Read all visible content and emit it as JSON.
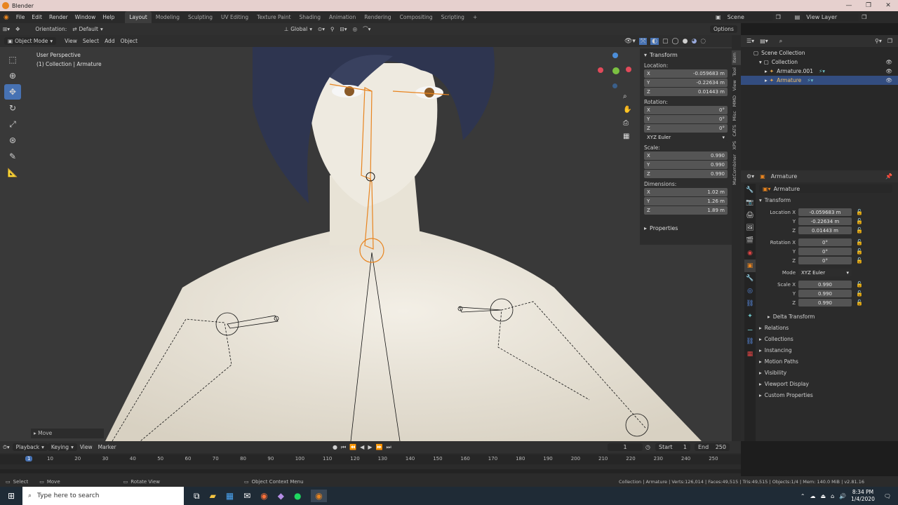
{
  "window": {
    "title": "Blender"
  },
  "menubar": {
    "menus": [
      "File",
      "Edit",
      "Render",
      "Window",
      "Help"
    ],
    "workspaces": [
      "Layout",
      "Modeling",
      "Sculpting",
      "UV Editing",
      "Texture Paint",
      "Shading",
      "Animation",
      "Rendering",
      "Compositing",
      "Scripting"
    ],
    "active_workspace": "Layout",
    "scene": "Scene",
    "view_layer": "View Layer"
  },
  "tool_header": {
    "orientation_label": "Orientation:",
    "orientation_value": "Default",
    "transform_orientation": "Global",
    "options": "Options"
  },
  "viewport_header": {
    "mode": "Object Mode",
    "menus": [
      "View",
      "Select",
      "Add",
      "Object"
    ]
  },
  "viewport": {
    "perspective": "User Perspective",
    "collection_info": "(1) Collection | Armature",
    "last_operator": "Move"
  },
  "npanel": {
    "title": "Transform",
    "location_label": "Location:",
    "location": [
      {
        "axis": "X",
        "value": "-0.059683 m"
      },
      {
        "axis": "Y",
        "value": "-0.22634 m"
      },
      {
        "axis": "Z",
        "value": "0.01443 m"
      }
    ],
    "rotation_label": "Rotation:",
    "rotation": [
      {
        "axis": "X",
        "value": "0°"
      },
      {
        "axis": "Y",
        "value": "0°"
      },
      {
        "axis": "Z",
        "value": "0°"
      }
    ],
    "rotation_mode": "XYZ Euler",
    "scale_label": "Scale:",
    "scale": [
      {
        "axis": "X",
        "value": "0.990"
      },
      {
        "axis": "Y",
        "value": "0.990"
      },
      {
        "axis": "Z",
        "value": "0.990"
      }
    ],
    "dimensions_label": "Dimensions:",
    "dimensions": [
      {
        "axis": "X",
        "value": "1.02 m"
      },
      {
        "axis": "Y",
        "value": "1.26 m"
      },
      {
        "axis": "Z",
        "value": "1.89 m"
      }
    ],
    "properties": "Properties",
    "tabs": [
      "Item",
      "Tool",
      "View",
      "MMD",
      "Misc",
      "CATS",
      "XPS",
      "MatCombiner"
    ]
  },
  "outliner": {
    "root": "Scene Collection",
    "collection": "Collection",
    "items": [
      "Armature.001",
      "Armature"
    ]
  },
  "properties": {
    "object_name": "Armature",
    "datablock": "Armature",
    "section": "Transform",
    "location_label": "Location X",
    "location": [
      "-0.059683 m",
      "-0.22634 m",
      "0.01443 m"
    ],
    "rotation_label": "Rotation X",
    "rotation": [
      "0°",
      "0°",
      "0°"
    ],
    "mode_label": "Mode",
    "mode": "XYZ Euler",
    "scale_label": "Scale X",
    "scale": [
      "0.990",
      "0.990",
      "0.990"
    ],
    "axis_y": "Y",
    "axis_z": "Z",
    "delta": "Delta Transform",
    "panels": [
      "Relations",
      "Collections",
      "Instancing",
      "Motion Paths",
      "Visibility",
      "Viewport Display",
      "Custom Properties"
    ]
  },
  "timeline": {
    "menus": [
      "Playback",
      "Keying",
      "View",
      "Marker"
    ],
    "current_frame": "1",
    "start_label": "Start",
    "start": "1",
    "end_label": "End",
    "end": "250",
    "ticks": [
      "1",
      "10",
      "20",
      "30",
      "40",
      "50",
      "60",
      "70",
      "80",
      "90",
      "100",
      "110",
      "120",
      "130",
      "140",
      "150",
      "160",
      "170",
      "180",
      "190",
      "200",
      "210",
      "220",
      "230",
      "240",
      "250"
    ]
  },
  "statusbar": {
    "select": "Select",
    "move": "Move",
    "rotate": "Rotate View",
    "context": "Object Context Menu",
    "stats": "Collection | Armature | Verts:126,014 | Faces:49,515 | Tris:49,515 | Objects:1/4 | Mem: 140.0 MiB | v2.81.16"
  },
  "taskbar": {
    "search_placeholder": "Type here to search",
    "time": "8:34 PM",
    "date": "1/4/2020"
  },
  "colors": {
    "accent": "#4772b3",
    "selection": "#e8841f",
    "viewport_bg": "#393939"
  }
}
